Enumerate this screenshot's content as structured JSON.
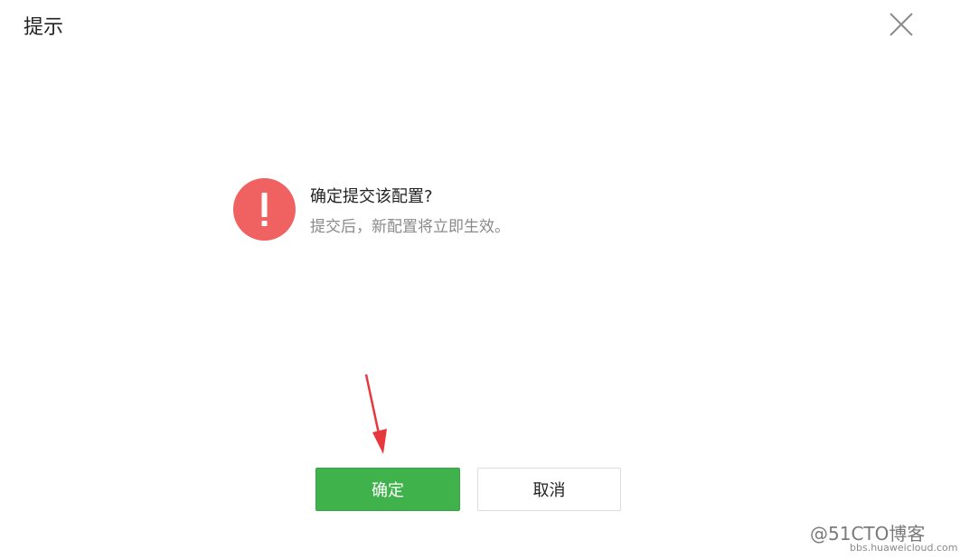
{
  "dialog": {
    "title": "提示",
    "close_icon": "close-icon"
  },
  "message": {
    "icon": "exclamation-icon",
    "icon_color": "#f06262",
    "title": "确定提交该配置?",
    "description": "提交后，新配置将立即生效。"
  },
  "annotation": {
    "arrow_color": "#e8383d"
  },
  "buttons": {
    "confirm_label": "确定",
    "confirm_color": "#3fb24b",
    "cancel_label": "取消"
  },
  "watermark": {
    "main": "@51CTO博客",
    "sub": "bbs.huaweicloud.com"
  }
}
